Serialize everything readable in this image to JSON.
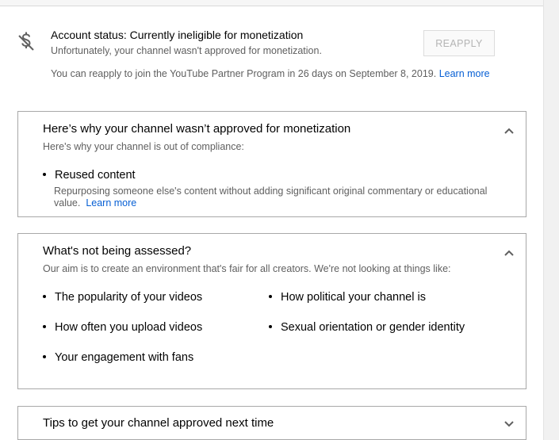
{
  "status": {
    "icon": "dollar-slash-icon",
    "title": "Account status: Currently ineligible for monetization",
    "subtitle": "Unfortunately, your channel wasn't approved for monetization.",
    "reapply_button": "REAPPLY",
    "reapply_text": "You can reapply to join the YouTube Partner Program in 26 days on September 8, 2019.",
    "learn_more": "Learn more"
  },
  "card_why": {
    "title": "Here’s why your channel wasn’t approved for monetization",
    "subtitle": "Here's why your channel is out of compliance:",
    "reason_title": "Reused content",
    "reason_desc": "Repurposing someone else's content without adding significant original commentary or educational value.",
    "learn_more": "Learn more",
    "chevron": "chevron-up-icon"
  },
  "card_not_assessed": {
    "title": "What's not being assessed?",
    "subtitle": "Our aim is to create an environment that's fair for all creators. We're not looking at things like:",
    "left_items": [
      "The popularity of your videos",
      "How often you upload videos",
      "Your engagement with fans"
    ],
    "right_items": [
      "How political your channel is",
      "Sexual orientation or gender identity"
    ],
    "chevron": "chevron-up-icon"
  },
  "card_tips": {
    "title": "Tips to get your channel approved next time",
    "chevron": "chevron-down-icon"
  },
  "colors": {
    "link": "#065fd4",
    "secondary_text": "#606060",
    "border": "#a8a8a8"
  }
}
